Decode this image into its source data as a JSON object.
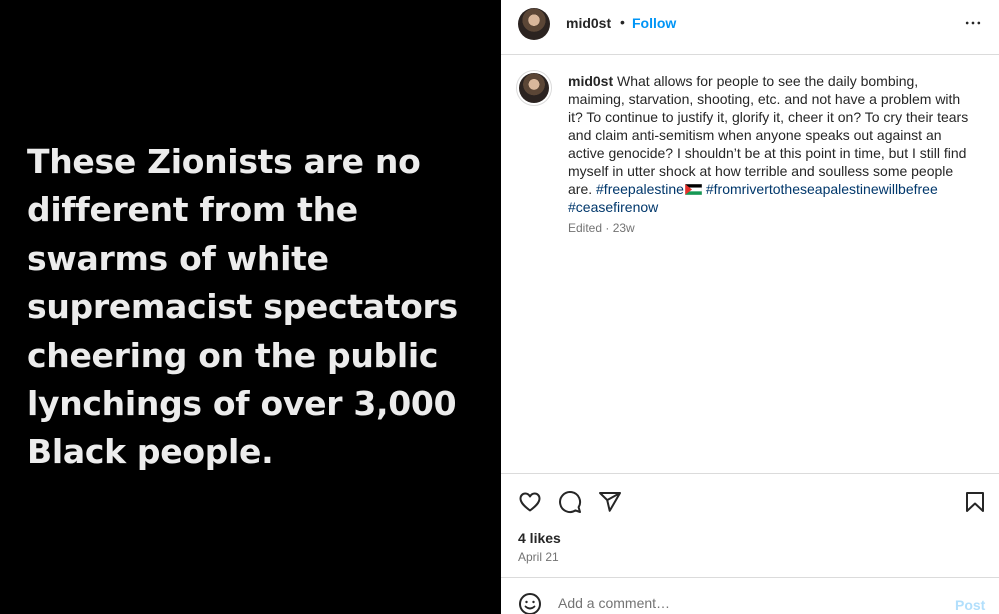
{
  "media": {
    "text": "These Zionists are no different from the swarms of white supremacist spectators cheering on the public lynchings of over 3,000 Black people.",
    "background": "#000000",
    "text_color": "#ececec"
  },
  "header": {
    "username": "mid0st",
    "separator": "•",
    "follow_label": "Follow",
    "more_icon": "more-horizontal-icon"
  },
  "caption": {
    "username": "mid0st",
    "text": "What allows for people to see the daily bombing, maiming, starvation, shooting, etc. and not have a problem with it? To continue to justify it, glorify it, cheer it on? To cry their tears and claim anti-semitism when anyone speaks out against an active genocide? I shouldn’t be at this point in time, but I still find myself in utter shock at how terrible and soulless some people are.",
    "hashtags": [
      "#freepalestine",
      "#fromrivertotheseapalestinewillbefree",
      "#ceasefirenow"
    ],
    "flag_icon": "palestine-flag-icon",
    "meta": "Edited · 23w"
  },
  "actions": {
    "like_icon": "heart-icon",
    "comment_icon": "comment-icon",
    "share_icon": "share-icon",
    "save_icon": "bookmark-icon",
    "likes": "4 likes",
    "date": "April 21"
  },
  "comment": {
    "placeholder": "Add a comment…",
    "post_label": "Post",
    "emoji_icon": "emoji-icon"
  },
  "colors": {
    "link_blue": "#0095f6",
    "hashtag": "#00376b",
    "muted": "#737373",
    "post_disabled": "#b2dffc"
  }
}
